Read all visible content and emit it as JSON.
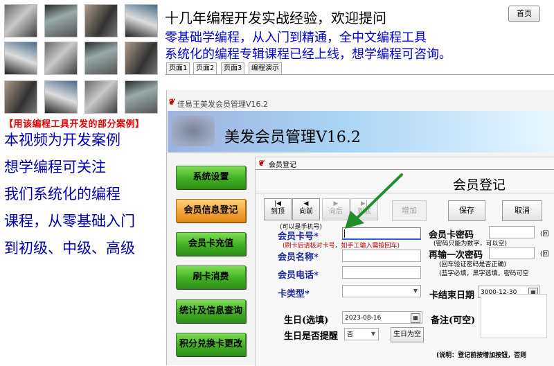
{
  "left_panel": {
    "case_title": "【用该编程工具开发的部分案例】",
    "lines": [
      "本视频为开发案例",
      "想学编程可关注",
      "我们系统化的编程",
      "课程，从零基础入门",
      "到初级、中级、高级"
    ]
  },
  "header": {
    "line1": "十几年编程开发实战经验，欢迎提问",
    "line2": "零基础学编程，从入门到精通，全中文编程工具",
    "line3": "系统化的编程专辑课程已经上线，想学编程可咨询。",
    "home_button": "首页"
  },
  "tabs": [
    "页面1",
    "页面2",
    "页面3",
    "编程演示"
  ],
  "app": {
    "logo": "❦",
    "title": "佳易王美发会员管理V16.2",
    "banner_title": "美发会员管理V16.2",
    "menu": [
      "系统设置",
      "会员信息登记",
      "会员卡充值",
      "刷卡消费",
      "统计及信息查询",
      "积分兑换卡更改"
    ]
  },
  "subwindow": {
    "title": "会员登记",
    "heading": "会员登记",
    "nav": [
      {
        "glyph": "|◀",
        "label": "到顶"
      },
      {
        "glyph": "◀",
        "label": "向前"
      },
      {
        "glyph": "▶",
        "label": "向后"
      },
      {
        "glyph": "▶|",
        "label": "到底"
      }
    ],
    "buttons": {
      "add": "增加",
      "save": "保存",
      "cancel": "取消"
    },
    "labels": {
      "card_no_hint": "(可以是手机号)",
      "card_no": "会员卡号*",
      "card_no_warning": "(刷卡后请核对卡号，如手工输入需按回车)",
      "name": "会员名称*",
      "phone": "会员电话*",
      "card_type": "卡类型*",
      "birthday": "生日(选填)",
      "birthday_remind": "生日是否提醒",
      "password": "会员卡密码",
      "password_hint": "(密码只能为数字，可以空)",
      "password_again": "再输一次密码",
      "password_again_hint": "(回车验证密码是否正确)",
      "blue_required_hint": "(蓝字必填，黑字选填，密码可空",
      "end_date": "卡结束日期",
      "note": "备注(可空)",
      "footer": "(说明：登记前按增加按钮，否则"
    },
    "values": {
      "birthday": "2023-08-16",
      "remind": "否",
      "birthday_empty_button": "生日为空",
      "end_date": "3000-12-30",
      "paren_right_1": "(回",
      "paren_right_2": "(回"
    }
  },
  "colors": {
    "arrow": "#1f8f2a",
    "menu_green": "#40b020",
    "menu_selected": "#f2a53a",
    "label_blue": "#1c2a9a"
  }
}
